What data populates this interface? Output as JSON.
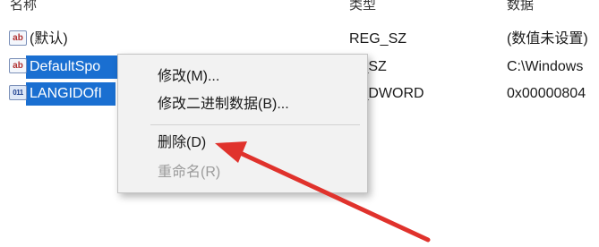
{
  "headers": {
    "name": "名称",
    "type": "类型",
    "data": "数据"
  },
  "rows": [
    {
      "icon": "string-value-icon",
      "icon_text": "ab",
      "name": "(默认)",
      "type": "REG_SZ",
      "data": "(数值未设置)",
      "selected": false
    },
    {
      "icon": "string-value-icon",
      "icon_text": "ab",
      "name": "DefaultSpo",
      "type": "G_SZ",
      "data": "C:\\Windows",
      "selected": true
    },
    {
      "icon": "binary-value-icon",
      "icon_text": "011",
      "name": "LANGIDOfI",
      "type": "G_DWORD",
      "data": "0x00000804",
      "selected": true
    }
  ],
  "context_menu": {
    "items": [
      {
        "label": "修改(M)...",
        "enabled": true
      },
      {
        "label": "修改二进制数据(B)...",
        "enabled": true
      },
      {
        "label": "删除(D)",
        "enabled": true
      },
      {
        "label": "重命名(R)",
        "enabled": false
      }
    ]
  },
  "colors": {
    "selection": "#1a6fd1",
    "arrow": "#e0322c",
    "menu_bg": "#f2f2f2"
  }
}
